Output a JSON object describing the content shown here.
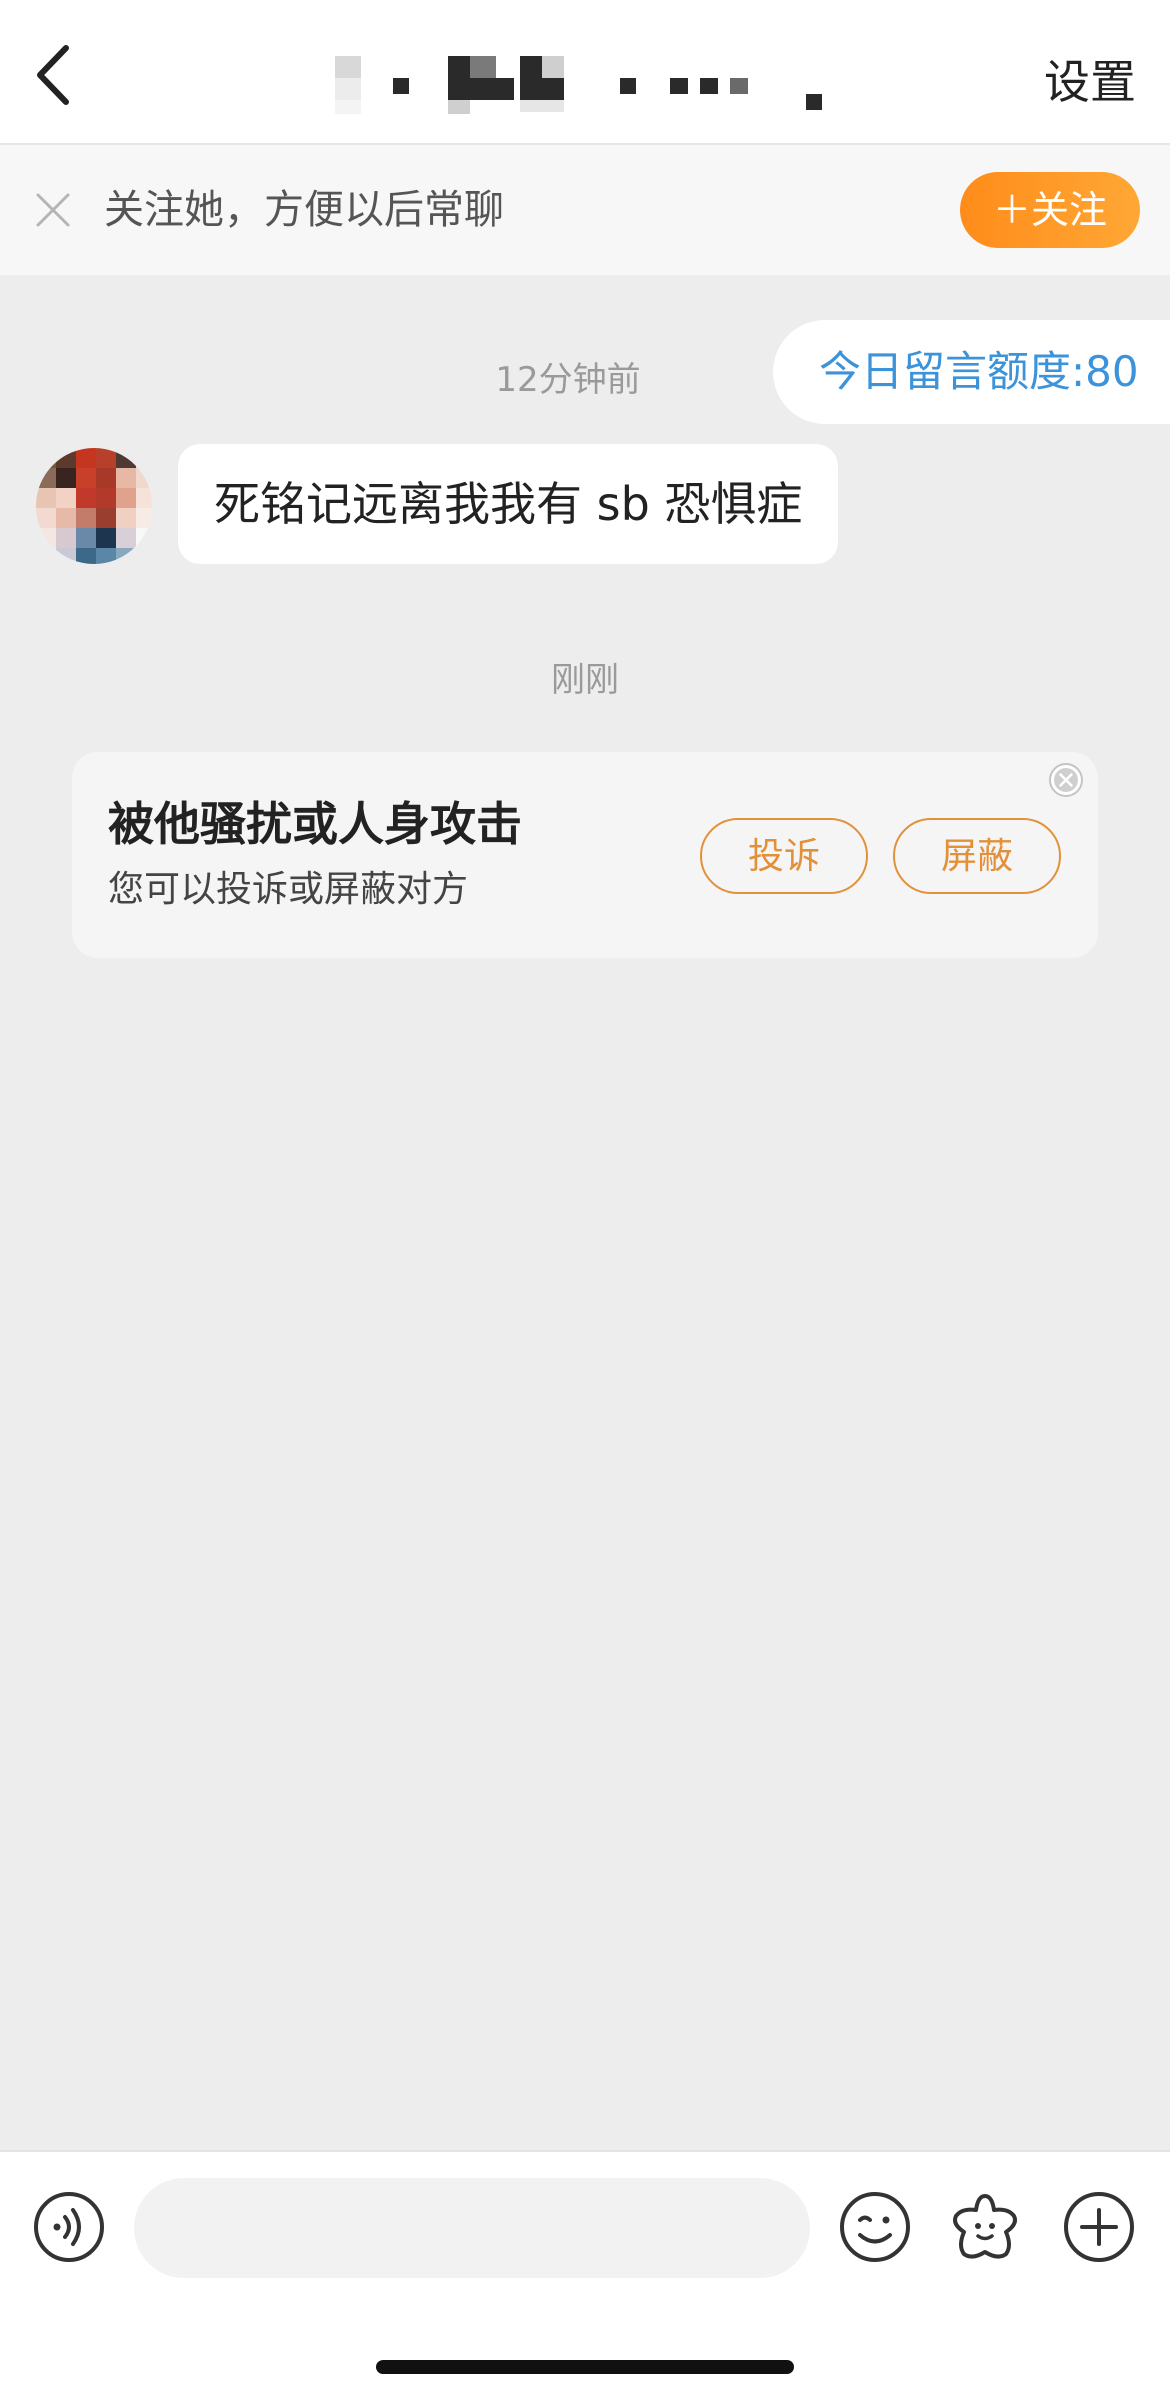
{
  "header": {
    "settings_label": "设置"
  },
  "follow_bar": {
    "text": "关注她，方便以后常聊",
    "button_label": "＋关注"
  },
  "chat": {
    "quota_label": "今日留言额度:80",
    "time_1": "12分钟前",
    "message_text": "死铭记远离我我有 sb 恐惧症",
    "time_2": "刚刚"
  },
  "harass_card": {
    "title": "被他骚扰或人身攻击",
    "subtitle": "您可以投诉或屏蔽对方",
    "report_label": "投诉",
    "block_label": "屏蔽"
  },
  "input_bar": {
    "placeholder": ""
  },
  "icons": {
    "back": "back-chevron-icon",
    "close": "close-icon",
    "voice": "voice-icon",
    "emoji": "emoji-icon",
    "sticker": "sticker-icon",
    "plus": "plus-icon"
  },
  "colors": {
    "accent_orange": "#ff9a26",
    "outline_orange": "#e2913a",
    "quota_blue": "#3d93d9",
    "background": "#ededed"
  }
}
